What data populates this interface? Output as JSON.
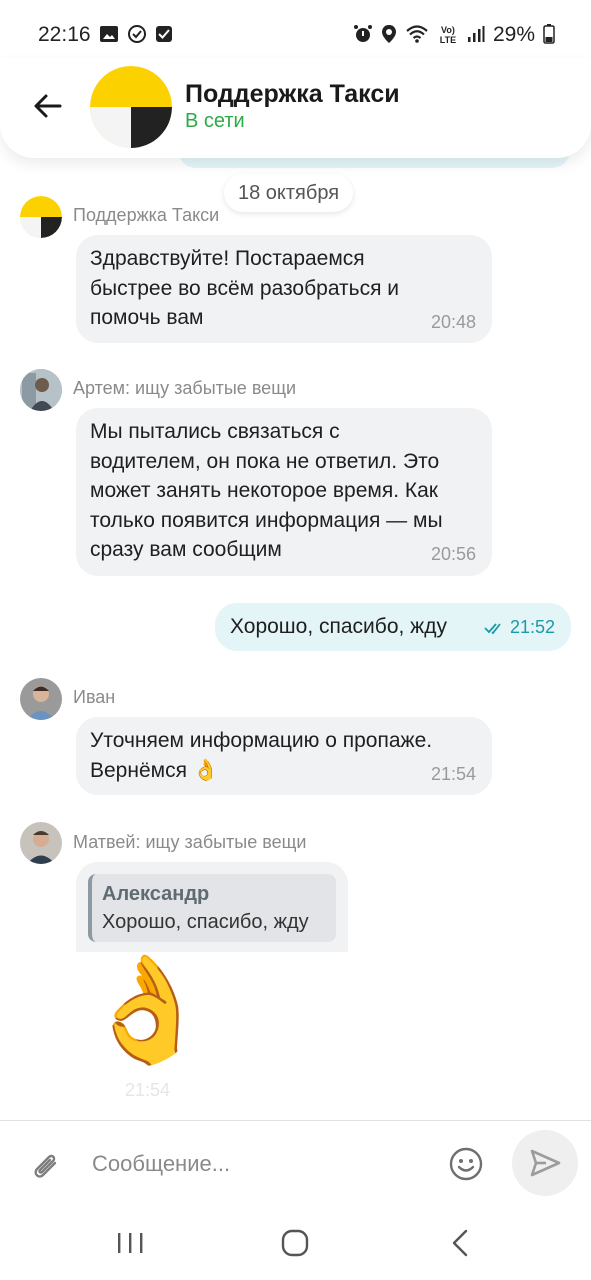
{
  "status_bar": {
    "time": "22:16",
    "network_label": "Vo) LTE",
    "battery": "29%"
  },
  "header": {
    "title": "Поддержка Такси",
    "status": "В сети"
  },
  "date_separator": "18 октября",
  "messages": [
    {
      "sender": "Поддержка Такси",
      "lines": [
        "Здравствуйте! Постараемся",
        "быстрее во всём разобраться и",
        "помочь вам"
      ],
      "time": "20:48"
    },
    {
      "sender": "Артем: ищу забытые вещи",
      "lines": [
        "Мы пытались связаться с",
        "водителем, он пока не ответил.  Это",
        "может занять некоторое время. Как",
        "только появится информация  — мы",
        "сразу вам сообщим"
      ],
      "time": "20:56"
    },
    {
      "text": "Хорошо, спасибо, жду",
      "time": "21:52"
    },
    {
      "sender": "Иван",
      "lines": [
        "Уточняем информацию о пропаже.",
        "Вернёмся"
      ],
      "time": "21:54"
    },
    {
      "sender": "Матвей: ищу забытые вещи",
      "quote_name": "Александр",
      "quote_text": "Хорошо, спасибо, жду",
      "emoji": "👌",
      "time": "21:54"
    }
  ],
  "composer": {
    "placeholder": "Сообщение..."
  },
  "icons": {
    "back": "arrow-left-icon",
    "attach": "paperclip-icon",
    "emoji": "smiley-icon",
    "send": "send-icon"
  },
  "colors": {
    "online_status": "#2eaa45",
    "outgoing_bubble": "#e3f5f7",
    "incoming_bubble": "#f1f2f4",
    "read_ticks": "#1b9aa8"
  }
}
